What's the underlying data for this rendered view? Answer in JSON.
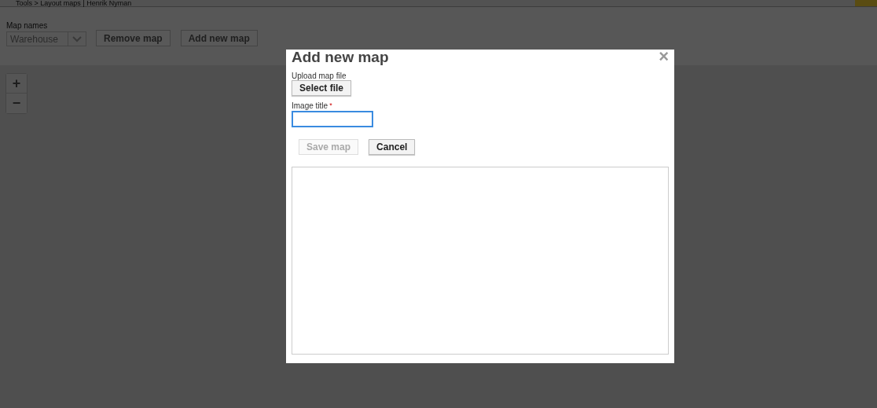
{
  "header": {
    "breadcrumb": "Tools > Layout maps | Henrik Nyman"
  },
  "toolbar": {
    "map_names_label": "Map names",
    "map_select": {
      "value": "Warehouse"
    },
    "buttons": [
      {
        "label": "Remove map"
      },
      {
        "label": "Add new map"
      }
    ]
  },
  "zoom_controls": [
    {
      "label": "+"
    },
    {
      "label": "−"
    }
  ],
  "dialog": {
    "title": "Add new map",
    "close": "×",
    "upload_label": "Upload map file",
    "select_file": "Select file",
    "image_title_label": "Image title",
    "required_mark": "*",
    "image_title_field": {
      "focused": true
    },
    "buttons": [
      {
        "label": "Save map",
        "disabled": true
      },
      {
        "label": "Cancel",
        "disabled": false
      }
    ]
  }
}
